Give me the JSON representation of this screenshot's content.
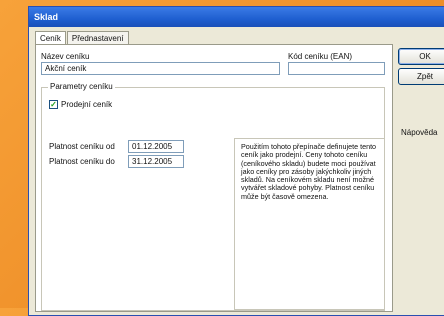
{
  "window": {
    "title": "Sklad"
  },
  "tabs": [
    {
      "label": "Ceník"
    },
    {
      "label": "Přednastavení"
    }
  ],
  "form": {
    "name_label": "Název ceníku",
    "name_value": "Akční ceník",
    "code_label": "Kód ceníku (EAN)",
    "code_value": ""
  },
  "params": {
    "group_label": "Parametry ceníku",
    "checkbox_label": "Prodejní ceník",
    "checked": true,
    "valid_from_label": "Platnost ceníku od",
    "valid_from_value": "01.12.2005",
    "valid_to_label": "Platnost ceníku do",
    "valid_to_value": "31.12.2005"
  },
  "help_text": "Použitím tohoto přepínače definujete tento ceník jako prodejní. Ceny tohoto ceníku (ceníkového skladu) budete moci používat jako ceníky pro zásoby jakýchkoliv jiných skladů. Na ceníkovém skladu není možné vytvářet skladové pohyby. Platnost ceníku může být časově omezena.",
  "buttons": {
    "ok": "OK",
    "back": "Zpět",
    "help": "Nápověda"
  }
}
